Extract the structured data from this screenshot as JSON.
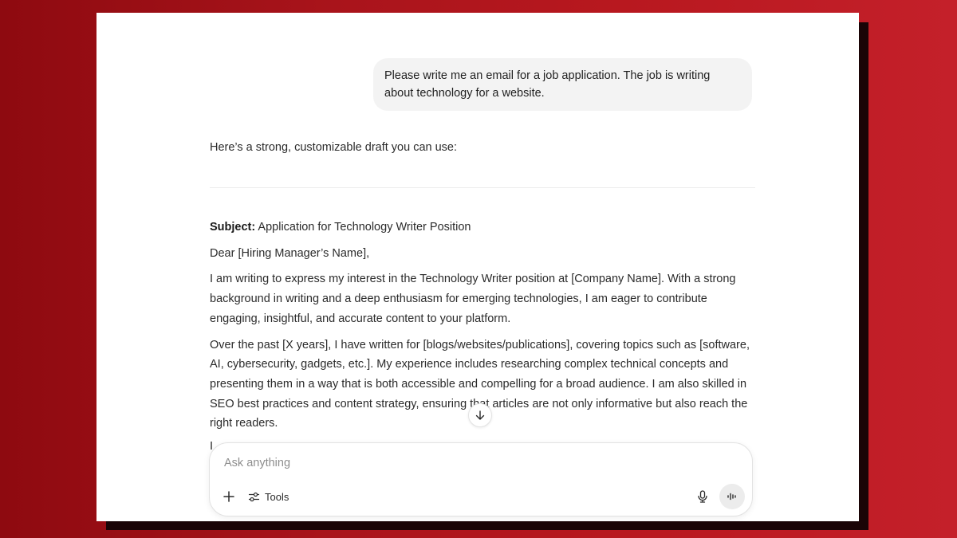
{
  "conversation": {
    "user_message": "Please write me an email for a job application. The job is writing about technology for a website.",
    "assistant_intro": "Here’s a strong, customizable draft you can use:",
    "email": {
      "subject_label": "Subject:",
      "subject_text": " Application for Technology Writer Position",
      "greeting": "Dear [Hiring Manager’s Name],",
      "paragraph_1": "I am writing to express my interest in the Technology Writer position at [Company Name]. With a strong background in writing and a deep enthusiasm for emerging technologies, I am eager to contribute engaging, insightful, and accurate content to your platform.",
      "paragraph_2": "Over the past [X years], I have written for [blogs/websites/publications], covering topics such as [software, AI, cybersecurity, gadgets, etc.]. My experience includes researching complex technical concepts and presenting them in a way that is both accessible and compelling for a broad audience. I am also skilled in SEO best practices and content strategy, ensuring that articles are not only informative but also reach the right readers.",
      "partial_line": "I"
    }
  },
  "composer": {
    "placeholder": "Ask anything",
    "tools_label": "Tools",
    "icons": {
      "add": "plus-icon",
      "tools": "sliders-icon",
      "mic": "microphone-icon",
      "voice": "voice-waveform-icon",
      "scroll": "arrow-down-icon"
    }
  },
  "colors": {
    "background_red": "#b8181f",
    "bubble": "#f3f3f3",
    "text": "#2b2b2b",
    "placeholder": "#8e8e8e"
  }
}
